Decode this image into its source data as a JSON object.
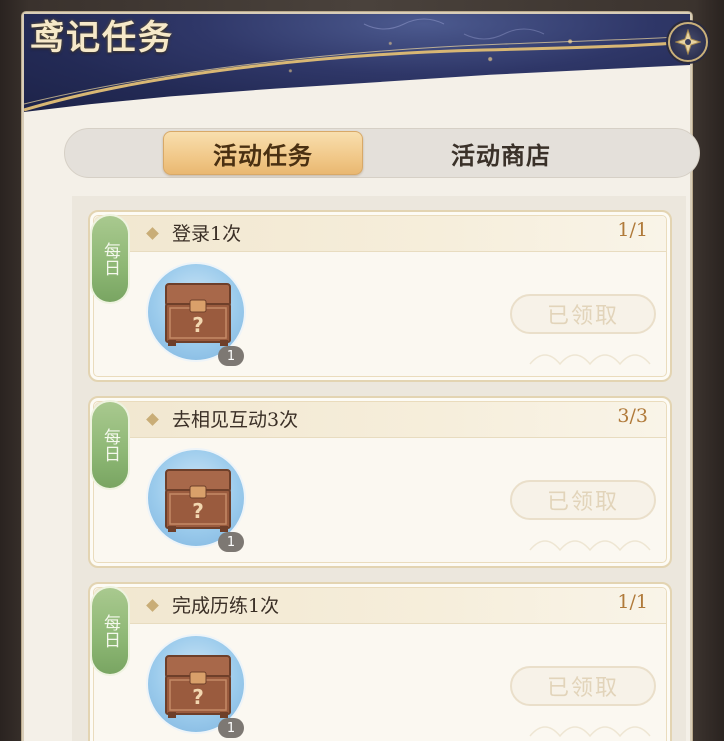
{
  "window": {
    "title": "鸢记任务",
    "close_icon": "close-star-icon"
  },
  "tabs": [
    {
      "label": "活动任务",
      "active": true
    },
    {
      "label": "活动商店",
      "active": false
    }
  ],
  "tasks": [
    {
      "tag": "每日",
      "title": "登录1次",
      "progress": "1/1",
      "reward_icon": "mystery-chest-icon",
      "reward_count": "1",
      "button_label": "已领取"
    },
    {
      "tag": "每日",
      "title": "去相见互动3次",
      "progress": "3/3",
      "reward_icon": "mystery-chest-icon",
      "reward_count": "1",
      "button_label": "已领取"
    },
    {
      "tag": "每日",
      "title": "完成历练1次",
      "progress": "1/1",
      "reward_icon": "mystery-chest-icon",
      "reward_count": "1",
      "button_label": "已领取"
    }
  ],
  "colors": {
    "header_navy": "#232a55",
    "accent_gold": "#c9b07a",
    "active_tab": "#f1c889",
    "daily_tag_green": "#8db774",
    "progress_text": "#b07a3a"
  }
}
